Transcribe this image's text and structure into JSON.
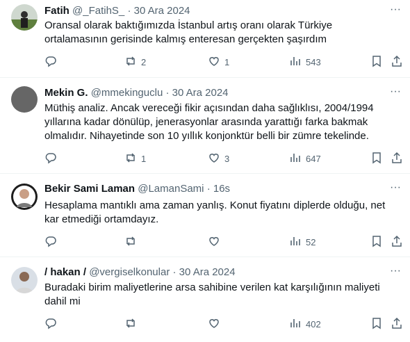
{
  "tweets": [
    {
      "name": "Fatih",
      "handle": "@_FatihS_",
      "separator": "·",
      "time": "30 Ara 2024",
      "text": "Oransal olarak baktığımızda İstanbul artış oranı olarak Türkiye ortalamasının gerisinde kalmış enteresan gerçekten şaşırdım",
      "replies": "",
      "retweets": "2",
      "likes": "1",
      "views": "543"
    },
    {
      "name": "Mekin G.",
      "handle": "@mmekinguclu",
      "separator": "·",
      "time": "30 Ara 2024",
      "text": "Müthiş analiz. Ancak vereceği fikir açısından daha sağlıklısı, 2004/1994 yıllarına kadar dönülüp, jenerasyonlar arasında yarattığı farka bakmak olmalıdır. Nihayetinde son 10 yıllık konjonktür belli bir zümre tekelinde.",
      "replies": "",
      "retweets": "1",
      "likes": "3",
      "views": "647"
    },
    {
      "name": "Bekir Sami Laman",
      "handle": "@LamanSami",
      "separator": "·",
      "time": "16s",
      "text": "Hesaplama mantıklı ama zaman yanlış. Konut fiyatını diplerde olduğu, net kar etmediği ortamdayız.",
      "replies": "",
      "retweets": "",
      "likes": "",
      "views": "52"
    },
    {
      "name": "/ hakan /",
      "handle": "@vergiselkonular",
      "separator": "·",
      "time": "30 Ara 2024",
      "text": "Buradaki birim maliyetlerine arsa sahibine verilen kat karşılığının maliyeti dahil mi",
      "replies": "",
      "retweets": "",
      "likes": "",
      "views": "402"
    }
  ],
  "icons": {
    "reply": "reply-icon",
    "retweet": "retweet-icon",
    "like": "heart-icon",
    "views": "views-icon",
    "bookmark": "bookmark-icon",
    "share": "share-icon",
    "more": "more-icon"
  },
  "colors": {
    "text": "#0f1419",
    "secondary": "#536471",
    "divider": "#eff3f4",
    "background": "#ffffff"
  }
}
